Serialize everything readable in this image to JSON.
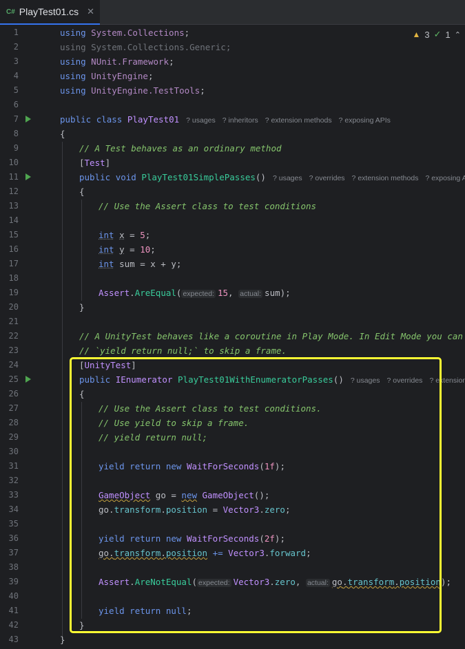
{
  "tab": {
    "lang_badge": "C#",
    "title": "PlayTest01.cs",
    "close_glyph": "✕"
  },
  "inspections": {
    "warning_count": "3",
    "ok_count": "1",
    "warning_icon": "warning-triangle-icon",
    "ok_icon": "checkmark-icon"
  },
  "hints": {
    "usages": "usages",
    "inheritors": "inheritors",
    "extension_methods": "extension methods",
    "exposing_apis": "exposing APIs",
    "overrides": "overrides",
    "exposing_a": "exposing A",
    "extension_m": "extension m",
    "expected": "expected:",
    "actual": "actual:",
    "q": "?"
  },
  "code": {
    "l1": [
      "using",
      "System.Collections",
      ";"
    ],
    "l2": "using System.Collections.Generic;",
    "l3": [
      "using",
      "NUnit.Framework",
      ";"
    ],
    "l4": [
      "using",
      "UnityEngine",
      ";"
    ],
    "l5": [
      "using",
      "UnityEngine.TestTools",
      ";"
    ],
    "l7": [
      "public",
      "class",
      "PlayTest01"
    ],
    "l8": "{",
    "l9": "// A Test behaves as an ordinary method",
    "l10": [
      "[",
      "Test",
      "]"
    ],
    "l11": [
      "public",
      "void",
      "PlayTest01SimplePasses",
      "()"
    ],
    "l12": "{",
    "l13": "// Use the Assert class to test conditions",
    "l15": [
      "int",
      "x",
      " = ",
      "5",
      ";"
    ],
    "l16": [
      "int",
      "y",
      " = ",
      "10",
      ";"
    ],
    "l17": [
      "int",
      " sum = x + y;"
    ],
    "l19": [
      "Assert",
      ".",
      "AreEqual",
      "(",
      "15",
      ", ",
      "sum",
      ");"
    ],
    "l20": "}",
    "l22": "// A UnityTest behaves like a coroutine in Play Mode. In Edit Mode you can use",
    "l23": "// `yield return null;` to skip a frame.",
    "l24": [
      "[",
      "UnityTest",
      "]"
    ],
    "l25": [
      "public",
      "IEnumerator",
      "PlayTest01WithEnumeratorPasses",
      "()"
    ],
    "l26": "{",
    "l27": "// Use the Assert class to test conditions.",
    "l28": "// Use yield to skip a frame.",
    "l29": "// yield return null;",
    "l31": [
      "yield",
      "return",
      "new",
      "WaitForSeconds",
      "(",
      "1f",
      ");"
    ],
    "l33": [
      "GameObject",
      " go = ",
      "new",
      "GameObject",
      "();"
    ],
    "l34": [
      "go.",
      "transform",
      ".",
      "position",
      " = ",
      "Vector3",
      ".",
      "zero",
      ";"
    ],
    "l36": [
      "yield",
      "return",
      "new",
      "WaitForSeconds",
      "(",
      "2f",
      ");"
    ],
    "l37": [
      "go.",
      "transform",
      ".",
      "position",
      " += ",
      "Vector3",
      ".",
      "forward",
      ";"
    ],
    "l39": [
      "Assert",
      ".",
      "AreNotEqual",
      "(",
      "Vector3",
      ".",
      "zero",
      ", ",
      "go",
      ".",
      "transform",
      ".",
      "position",
      ");"
    ],
    "l41": [
      "yield",
      "return",
      "null",
      ";"
    ],
    "l42": "}",
    "l43": "}"
  },
  "line_numbers": [
    "1",
    "2",
    "3",
    "4",
    "5",
    "6",
    "7",
    "8",
    "9",
    "10",
    "11",
    "12",
    "13",
    "14",
    "15",
    "16",
    "17",
    "18",
    "19",
    "20",
    "21",
    "22",
    "23",
    "24",
    "25",
    "26",
    "27",
    "28",
    "29",
    "30",
    "31",
    "32",
    "33",
    "34",
    "35",
    "36",
    "37",
    "38",
    "39",
    "40",
    "41",
    "42",
    "43"
  ],
  "colors": {
    "highlight_box": "#ffff33",
    "run_gutter": "#4fa550",
    "background": "#1e1f22"
  }
}
